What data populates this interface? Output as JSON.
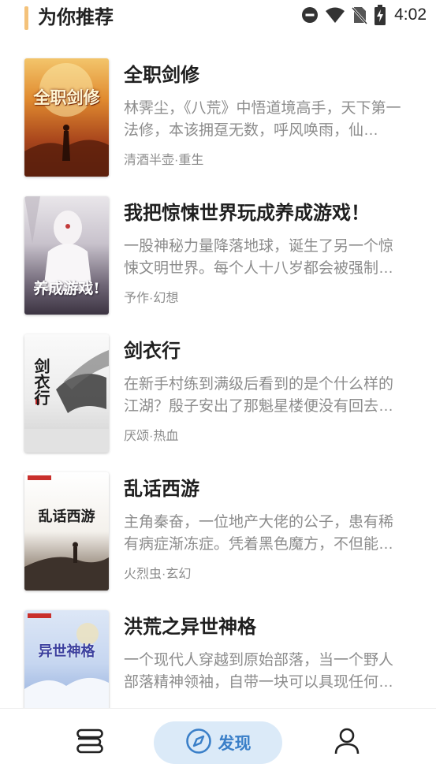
{
  "header": {
    "title": "为你推荐"
  },
  "status_bar": {
    "time": "4:02",
    "icons": [
      "do-not-disturb-icon",
      "wifi-icon",
      "no-sim-icon",
      "battery-charging-icon"
    ]
  },
  "books": [
    {
      "title": "全职剑修",
      "description": "林霁尘，《八荒》中悟道境高手，天下第一法修，本该拥趸无数，呼风唤雨，仙…",
      "meta": "清酒半壶·重生",
      "cover_text": "全职剑修"
    },
    {
      "title": "我把惊悚世界玩成养成游戏！",
      "description": "一股神秘力量降落地球，诞生了另一个惊悚文明世界。每个人十八岁都会被强制…",
      "meta": "予作·幻想",
      "cover_text": "养成游戏!"
    },
    {
      "title": "剑衣行",
      "description": "在新手村练到满级后看到的是个什么样的江湖？殷子安出了那魁星楼便没有回去…",
      "meta": "厌颂·热血",
      "cover_text": "剑衣行"
    },
    {
      "title": "乱话西游",
      "description": "主角秦奋，一位地产大佬的公子，患有稀有病症渐冻症。凭着黑色魔方，不但能…",
      "meta": "火烈虫·玄幻",
      "cover_text": "乱话西游"
    },
    {
      "title": "洪荒之异世神格",
      "description": "一个现代人穿越到原始部落，当一个野人部落精神领袖，自带一块可以具现任何…",
      "meta": "",
      "cover_text": "异世神格"
    }
  ],
  "nav": {
    "discover_label": "发现"
  },
  "colors": {
    "accent_bar": "#f4c27a",
    "nav_active_bg": "#dbeaf8",
    "nav_active_text": "#3a7fc8"
  }
}
